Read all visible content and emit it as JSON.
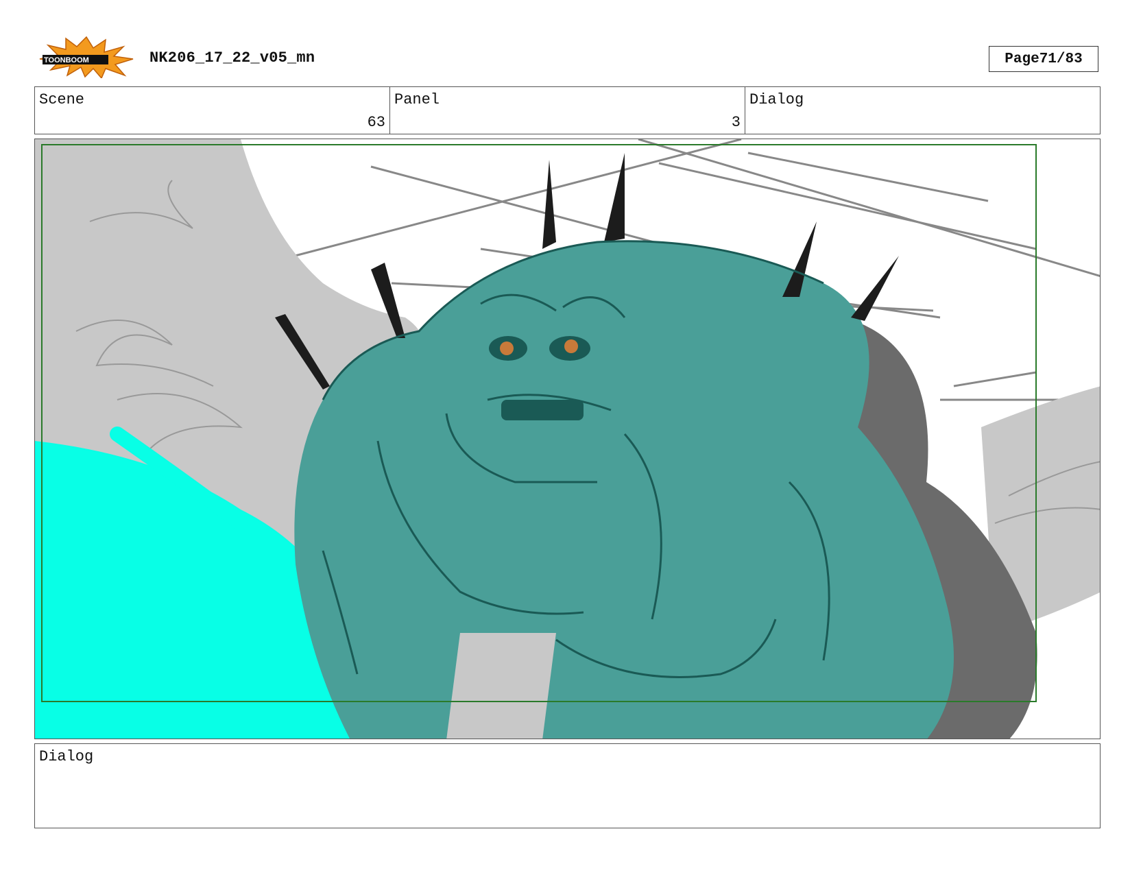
{
  "header": {
    "logo_name": "toonboom-logo",
    "logo_text": "TOONBOOM",
    "doc_title": "NK206_17_22_v05_mn",
    "page_label": "Page",
    "page_number": "71/83"
  },
  "info": {
    "scene_label": "Scene",
    "scene_value": "63",
    "panel_label": "Panel",
    "panel_value": "3",
    "dialog_label": "Dialog",
    "dialog_value": ""
  },
  "artwork": {
    "subject": "creature-sketch-icon",
    "colors": {
      "creature": "#4a9f98",
      "glow": "#00ffee",
      "rock": "#c8c8c8",
      "shadow": "#6b6b6b",
      "line": "#1a5a55",
      "safe_frame": "#2a7a2a",
      "eyes": "#c87a3a"
    }
  },
  "dialog": {
    "label": "Dialog",
    "text": ""
  }
}
